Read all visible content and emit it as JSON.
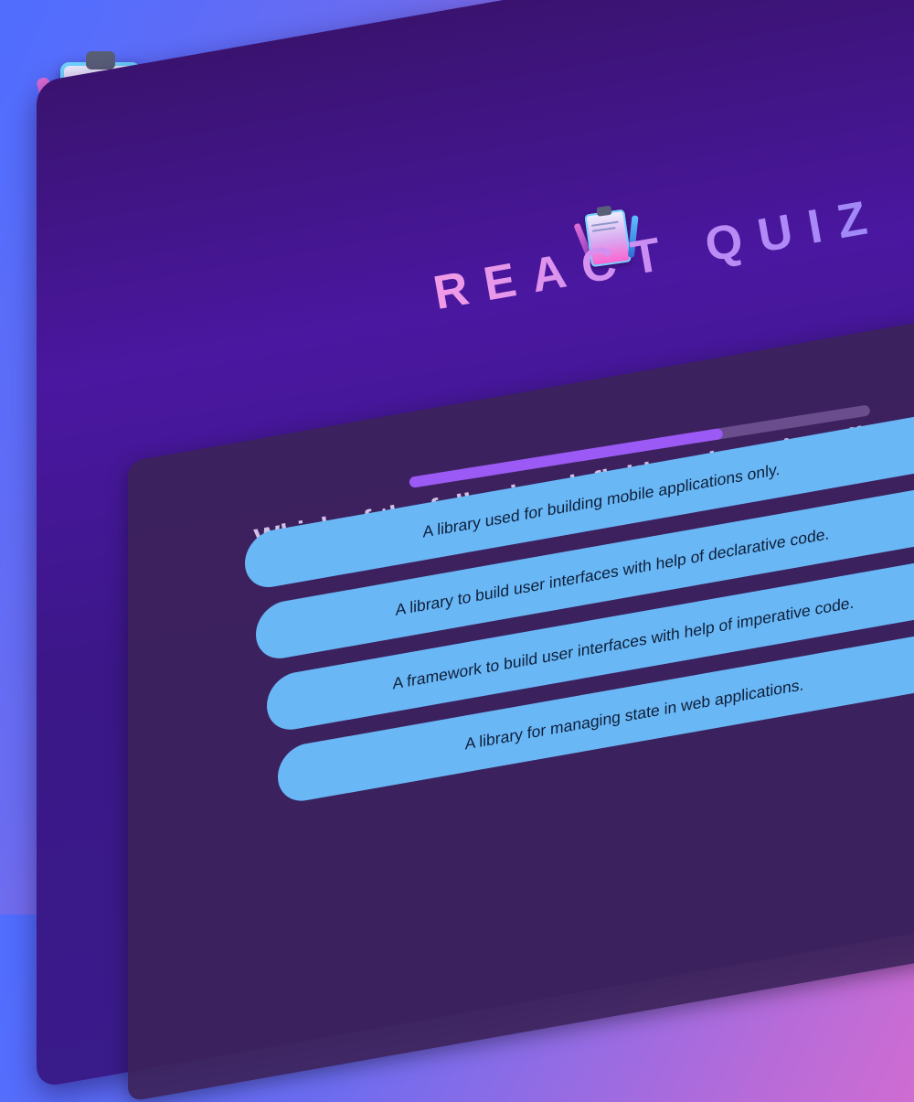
{
  "app": {
    "title": "REACT QUIZ"
  },
  "quiz": {
    "progress": 0.68,
    "question": "Which of the following definitions best describes React.js?",
    "answers": [
      "A library used for building mobile applications only.",
      "A library to build user interfaces with help of declarative code.",
      "A framework to build user interfaces with help of imperative code.",
      "A library for managing state in web applications."
    ]
  },
  "colors": {
    "progress_fill": "#9b59f5",
    "answer_bg": "#6ab7f5",
    "card_bg": "#3c235a",
    "window_bg": "#4a17a0"
  },
  "icons": {
    "logo": "clipboard-quiz-icon"
  }
}
